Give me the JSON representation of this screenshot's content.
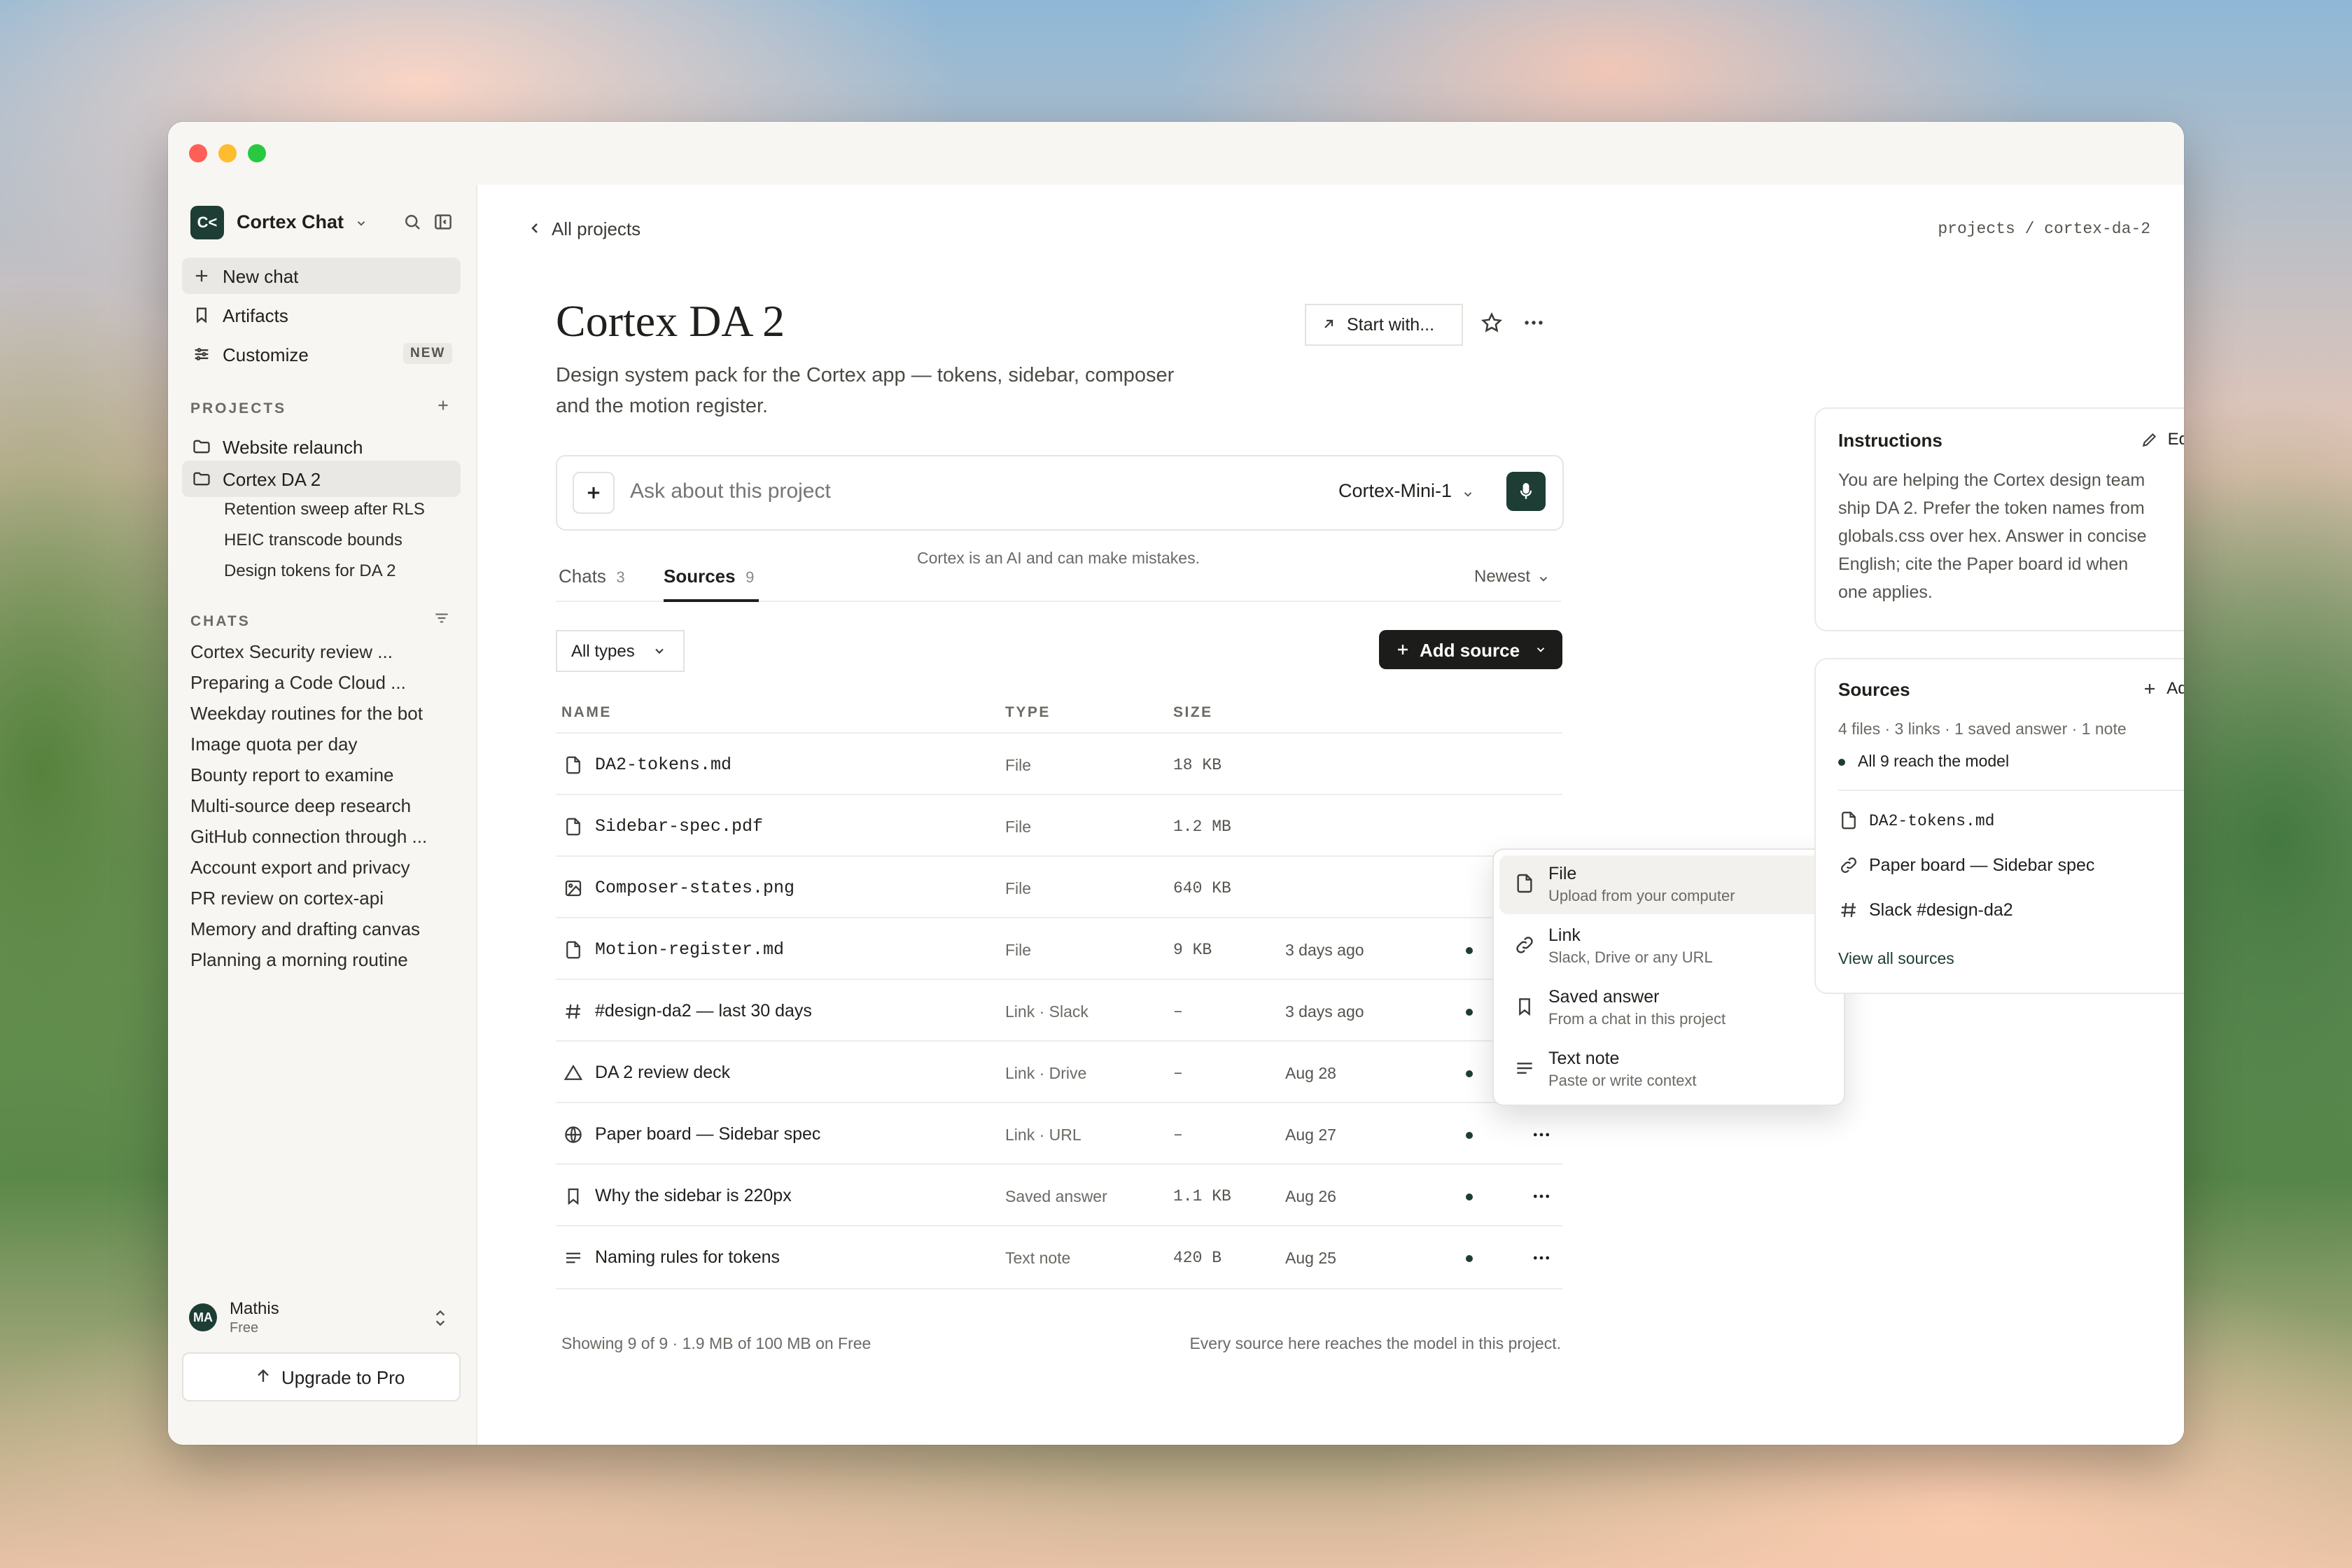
{
  "app": {
    "name": "Cortex Chat",
    "logo_text": "C<",
    "accent": "#1d3d35"
  },
  "sidebar": {
    "nav": [
      {
        "label": "New chat",
        "icon": "plus-icon"
      },
      {
        "label": "Artifacts",
        "icon": "bookmark-icon"
      },
      {
        "label": "Customize",
        "icon": "sliders-icon",
        "badge": "NEW"
      }
    ],
    "projects_heading": "PROJECTS",
    "projects": [
      {
        "label": "Website relaunch",
        "icon": "folder-icon"
      },
      {
        "label": "Cortex DA 2",
        "icon": "folder-icon",
        "selected": true
      }
    ],
    "project_chats": [
      "Retention sweep after RLS",
      "HEIC transcode bounds",
      "Design tokens for DA 2"
    ],
    "chats_heading": "CHATS",
    "chats": [
      "Cortex Security review ...",
      "Preparing a Code Cloud ...",
      "Weekday routines for the bot",
      "Image quota per day",
      "Bounty report to examine",
      "Multi-source deep research",
      "GitHub connection through ...",
      "Account export and privacy",
      "PR review on cortex-api",
      "Memory and drafting canvas",
      "Planning a morning routine"
    ],
    "user": {
      "initials": "MA",
      "name": "Mathis",
      "plan": "Free"
    },
    "upgrade_label": "Upgrade to Pro"
  },
  "header": {
    "back_label": "All projects",
    "breadcrumb": "projects / cortex-da-2"
  },
  "project": {
    "title": "Cortex DA 2",
    "description_line1": "Design system pack for the Cortex app — tokens, sidebar, composer",
    "description_line2": "and the motion register.",
    "start_with_label": "Start with..."
  },
  "composer": {
    "placeholder": "Ask about this project",
    "model": "Cortex-Mini-1",
    "disclaimer": "Cortex is an AI and can make mistakes."
  },
  "tabs": [
    {
      "label": "Chats",
      "count": "3"
    },
    {
      "label": "Sources",
      "count": "9",
      "active": true
    }
  ],
  "sort_label": "Newest",
  "filter_label": "All types",
  "add_source_label": "Add source",
  "table": {
    "headers": {
      "name": "NAME",
      "type": "TYPE",
      "size": "SIZE"
    },
    "rows": [
      {
        "name": "DA2-tokens.md",
        "mono": true,
        "type": "File",
        "size": "18 KB",
        "added": "",
        "icon": "file-icon"
      },
      {
        "name": "Sidebar-spec.pdf",
        "mono": true,
        "type": "File",
        "size": "1.2 MB",
        "added": "",
        "icon": "file-icon"
      },
      {
        "name": "Composer-states.png",
        "mono": true,
        "type": "File",
        "size": "640 KB",
        "added": "",
        "icon": "image-icon"
      },
      {
        "name": "Motion-register.md",
        "mono": true,
        "type": "File",
        "size": "9 KB",
        "added": "3 days ago",
        "icon": "file-icon"
      },
      {
        "name": "#design-da2 — last 30 days",
        "mono": false,
        "type": "Link · Slack",
        "size": "–",
        "added": "3 days ago",
        "icon": "hash-icon"
      },
      {
        "name": "DA 2 review deck",
        "mono": false,
        "type": "Link · Drive",
        "size": "–",
        "added": "Aug 28",
        "icon": "drive-icon"
      },
      {
        "name": "Paper board — Sidebar spec",
        "mono": false,
        "type": "Link · URL",
        "size": "–",
        "added": "Aug 27",
        "icon": "globe-icon"
      },
      {
        "name": "Why the sidebar is 220px",
        "mono": false,
        "type": "Saved answer",
        "size": "1.1 KB",
        "added": "Aug 26",
        "icon": "bookmark-icon"
      },
      {
        "name": "Naming rules for tokens",
        "mono": false,
        "type": "Text note",
        "size": "420 B",
        "added": "Aug 25",
        "icon": "lines-icon"
      }
    ],
    "footer_left": "Showing 9 of 9 · 1.9 MB of 100 MB on Free",
    "footer_right": "Every source here reaches the model in this project."
  },
  "add_menu": [
    {
      "title": "File",
      "subtitle": "Upload from your computer",
      "icon": "file-icon"
    },
    {
      "title": "Link",
      "subtitle": "Slack, Drive or any URL",
      "icon": "link-icon"
    },
    {
      "title": "Saved answer",
      "subtitle": "From a chat in this project",
      "icon": "bookmark-icon"
    },
    {
      "title": "Text note",
      "subtitle": "Paste or write context",
      "icon": "lines-icon"
    }
  ],
  "instructions": {
    "title": "Instructions",
    "edit_label": "Edit",
    "lines": [
      "You are helping the Cortex design team",
      "ship DA 2. Prefer the token names from",
      "globals.css over hex. Answer in concise",
      "English; cite the Paper board id when",
      "one applies."
    ]
  },
  "sources_panel": {
    "title": "Sources",
    "add_label": "Add",
    "summary": "4 files · 3 links · 1 saved answer · 1 note",
    "reach": "All 9 reach the model",
    "items": [
      {
        "label": "DA2-tokens.md",
        "mono": true,
        "icon": "file-icon"
      },
      {
        "label": "Paper board — Sidebar spec",
        "mono": false,
        "icon": "link-icon"
      },
      {
        "label": "Slack #design-da2",
        "mono": false,
        "icon": "hash-icon"
      }
    ],
    "view_all_label": "View all sources"
  }
}
